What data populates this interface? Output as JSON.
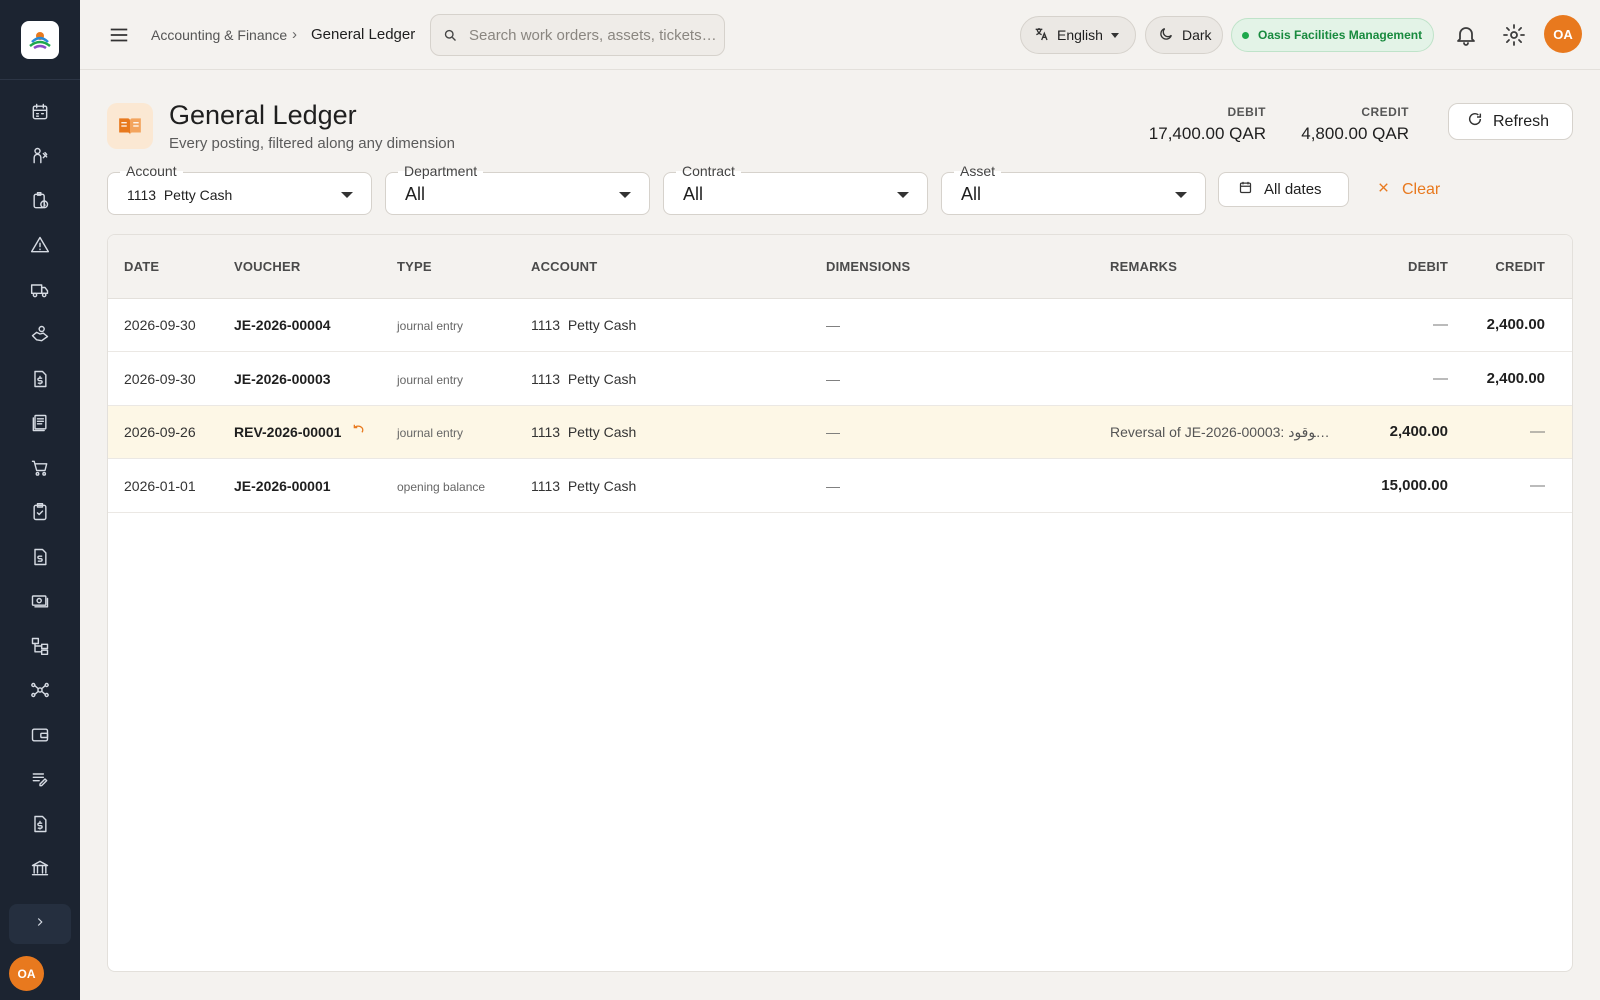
{
  "app": {
    "logo_name": "app-logo",
    "accent_color": "#e8791e",
    "sidebar_bg": "#1c2431"
  },
  "sidebar": {
    "items": [
      {
        "name": "calendar-icon"
      },
      {
        "name": "technician-icon"
      },
      {
        "name": "clipboard-clock-icon"
      },
      {
        "name": "warning-icon"
      },
      {
        "name": "truck-icon"
      },
      {
        "name": "hand-money-icon"
      },
      {
        "name": "document-dollar-icon"
      },
      {
        "name": "ledger-book-icon"
      },
      {
        "name": "cart-icon"
      },
      {
        "name": "clipboard-check-icon"
      },
      {
        "name": "invoice-icon"
      },
      {
        "name": "cash-icon"
      },
      {
        "name": "hierarchy-icon"
      },
      {
        "name": "network-icon"
      },
      {
        "name": "wallet-icon"
      },
      {
        "name": "notes-edit-icon"
      },
      {
        "name": "receipt-icon"
      },
      {
        "name": "bank-icon"
      }
    ],
    "user_initials": "OA"
  },
  "topbar": {
    "breadcrumb_parent": "Accounting & Finance",
    "breadcrumb_sep": "›",
    "breadcrumb_current": "General Ledger",
    "search_placeholder": "Search work orders, assets, tickets…",
    "language": "English",
    "theme_label": "Dark",
    "organization": "Oasis Facilities Management",
    "user_initials": "OA"
  },
  "header": {
    "title": "General Ledger",
    "subtitle": "Every posting, filtered along any dimension",
    "debit_label": "DEBIT",
    "debit_value": "17,400.00 QAR",
    "credit_label": "CREDIT",
    "credit_value": "4,800.00 QAR",
    "refresh_label": "Refresh"
  },
  "filters": {
    "account_label": "Account",
    "account_value": "1113  Petty Cash",
    "department_label": "Department",
    "department_value": "All",
    "contract_label": "Contract",
    "contract_value": "All",
    "asset_label": "Asset",
    "asset_value": "All",
    "dates_label": "All dates",
    "clear_label": "Clear"
  },
  "table": {
    "columns": {
      "date": "DATE",
      "voucher": "VOUCHER",
      "type": "TYPE",
      "account": "ACCOUNT",
      "dimensions": "DIMENSIONS",
      "remarks": "REMARKS",
      "debit": "DEBIT",
      "credit": "CREDIT"
    },
    "rows": [
      {
        "date": "2026-09-30",
        "voucher": "JE-2026-00004",
        "type": "journal entry",
        "account": "1113  Petty Cash",
        "dimensions": "—",
        "remarks": "",
        "debit": "—",
        "credit": "2,400.00",
        "highlight": false,
        "reversal": false
      },
      {
        "date": "2026-09-30",
        "voucher": "JE-2026-00003",
        "type": "journal entry",
        "account": "1113  Petty Cash",
        "dimensions": "—",
        "remarks": "",
        "debit": "—",
        "credit": "2,400.00",
        "highlight": false,
        "reversal": false
      },
      {
        "date": "2026-09-26",
        "voucher": "REV-2026-00001",
        "type": "journal entry",
        "account": "1113  Petty Cash",
        "dimensions": "—",
        "remarks": "Reversal of JE-2026-00003: الوقود…",
        "debit": "2,400.00",
        "credit": "—",
        "highlight": true,
        "reversal": true
      },
      {
        "date": "2026-01-01",
        "voucher": "JE-2026-00001",
        "type": "opening balance",
        "account": "1113  Petty Cash",
        "dimensions": "—",
        "remarks": "",
        "debit": "15,000.00",
        "credit": "—",
        "highlight": false,
        "reversal": false
      }
    ]
  }
}
